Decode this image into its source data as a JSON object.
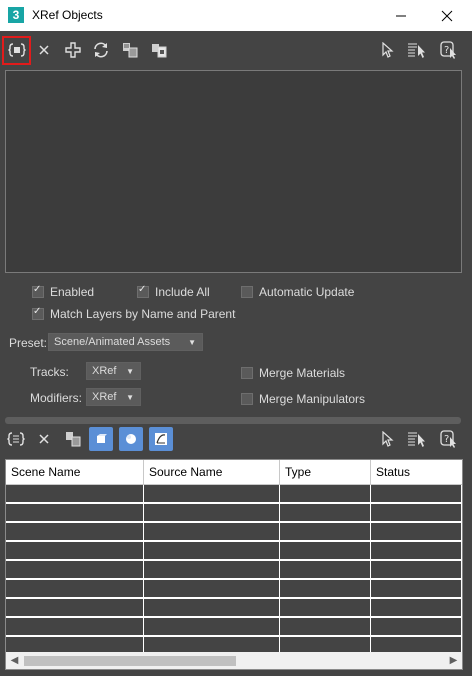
{
  "window": {
    "title": "XRef Objects",
    "app_icon": "3"
  },
  "top_toolbar": {
    "icons": [
      "create-xref-record-icon",
      "remove-icon",
      "add-objects-icon",
      "refresh-icon",
      "merge-in-scene-icon",
      "convert-selected-icon",
      "select-icon",
      "select-by-name-icon",
      "highlight-selected-icon"
    ]
  },
  "options": {
    "enabled": {
      "label": "Enabled",
      "checked": true
    },
    "include_all": {
      "label": "Include All",
      "checked": true
    },
    "automatic_update": {
      "label": "Automatic Update",
      "checked": false
    },
    "match_layers": {
      "label": "Match Layers by Name and Parent",
      "checked": true
    },
    "preset_label": "Preset:",
    "preset_value": "Scene/Animated Assets",
    "tracks_label": "Tracks:",
    "tracks_value": "XRef",
    "modifiers_label": "Modifiers:",
    "modifiers_value": "XRef",
    "merge_materials": {
      "label": "Merge Materials",
      "checked": false
    },
    "merge_manipulators": {
      "label": "Merge Manipulators",
      "checked": false
    }
  },
  "entities_table": {
    "columns": [
      "Scene Name",
      "Source Name",
      "Type",
      "Status"
    ]
  }
}
